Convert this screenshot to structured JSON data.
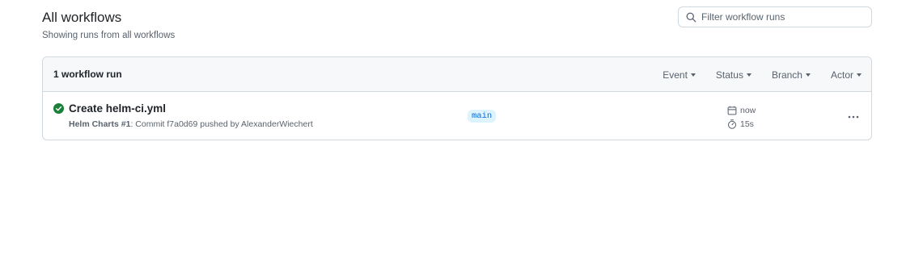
{
  "header": {
    "title": "All workflows",
    "subtitle": "Showing runs from all workflows"
  },
  "search": {
    "placeholder": "Filter workflow runs",
    "icon": "search-icon"
  },
  "runs": {
    "count_label": "1 workflow run",
    "filters": [
      "Event",
      "Status",
      "Branch",
      "Actor"
    ],
    "items": [
      {
        "status": "success",
        "status_color": "#1a7f37",
        "title": "Create helm-ci.yml",
        "workflow": "Helm Charts #1",
        "meta": ": Commit f7a0d69 pushed by AlexanderWiechert",
        "branch": "main",
        "time": "now",
        "duration": "15s"
      }
    ]
  },
  "colors": {
    "accent": "#0969da",
    "badge_bg": "#ddf4ff",
    "muted_text": "#59636e",
    "border": "#d1d9e0",
    "header_bg": "#f6f8fa"
  }
}
